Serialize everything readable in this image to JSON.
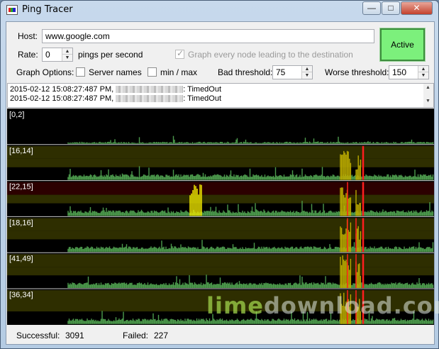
{
  "window": {
    "title": "Ping Tracer"
  },
  "controls": {
    "host_label": "Host:",
    "host_value": "www.google.com",
    "rate_label": "Rate:",
    "rate_value": "0",
    "rate_unit": "pings per second",
    "graph_every_node_label": "Graph every node leading to the destination",
    "graph_every_node_checked": true,
    "graph_options_label": "Graph Options:",
    "server_names_label": "Server names",
    "server_names_checked": false,
    "minmax_label": "min / max",
    "minmax_checked": false,
    "bad_threshold_label": "Bad threshold:",
    "bad_threshold_value": "75",
    "worse_threshold_label": "Worse threshold:",
    "worse_threshold_value": "150",
    "active_button_label": "Active"
  },
  "log": [
    {
      "timestamp": "2015-02-12 15:08:27:487 PM,",
      "status": ": TimedOut"
    },
    {
      "timestamp": "2015-02-12 15:08:27:487 PM,",
      "status": ": TimedOut"
    }
  ],
  "graphs": [
    {
      "label": "[0,2]"
    },
    {
      "label": "[16,14]"
    },
    {
      "label": "[22,15]"
    },
    {
      "label": "[18,16]"
    },
    {
      "label": "[41,49]"
    },
    {
      "label": "[36,34]"
    }
  ],
  "status": {
    "successful_label": "Successful:",
    "successful_value": "3091",
    "failed_label": "Failed:",
    "failed_value": "227"
  },
  "watermark": {
    "prefix": "lime",
    "suffix": "download.com"
  },
  "colors": {
    "bad_band": "#2e2e00",
    "worse_band": "#2c0000",
    "ping_bar": "#4c9a4c",
    "bad_bar": "#b8a800",
    "timeout_line": "#ff1e1e",
    "active_button": "#7cf07c"
  }
}
